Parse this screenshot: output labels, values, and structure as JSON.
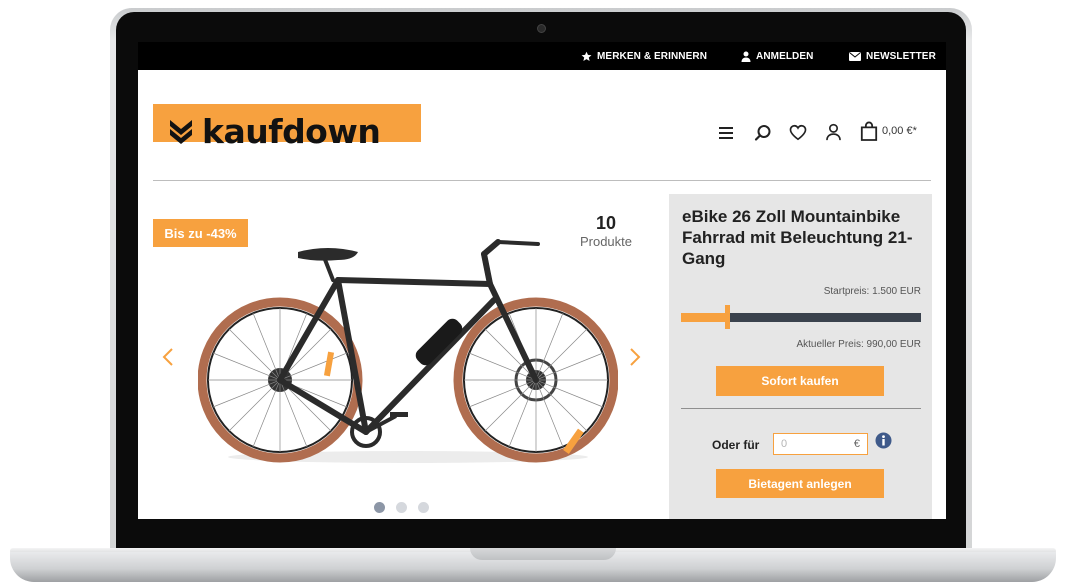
{
  "topbar": {
    "items": [
      {
        "label": "MERKEN & ERINNERN",
        "icon": "star-icon"
      },
      {
        "label": "ANMELDEN",
        "icon": "user-icon"
      },
      {
        "label": "NEWSLETTER",
        "icon": "envelope-icon"
      }
    ]
  },
  "header": {
    "logo_text": "kaufdown",
    "icons": [
      "menu-icon",
      "search-icon",
      "heart-icon",
      "account-icon",
      "cart-icon"
    ],
    "cart_amount": "0,00 €*"
  },
  "product": {
    "discount_badge": "Bis zu -43%",
    "count_number": "10",
    "count_label": "Produkte",
    "image_description": "Black electric city bike with orange-brown tires",
    "carousel_dots": 3,
    "active_dot": 0
  },
  "panel": {
    "title": "eBike 26 Zoll Mountainbike Fahrrad mit Beleuchtung 21-Gang",
    "start_price": "Startpreis: 1.500 EUR",
    "current_price": "Aktueller Preis: 990,00 EUR",
    "price_progress": 0.19,
    "buy_button": "Sofort kaufen",
    "bid_label": "Oder für",
    "bid_placeholder": "0",
    "bid_currency": "€",
    "bid_agent_button": "Bietagent anlegen"
  },
  "colors": {
    "accent": "#f7a13f",
    "slider_track": "#3a424d",
    "panel_bg": "#e6e6e6",
    "topbar_bg": "#000000"
  }
}
